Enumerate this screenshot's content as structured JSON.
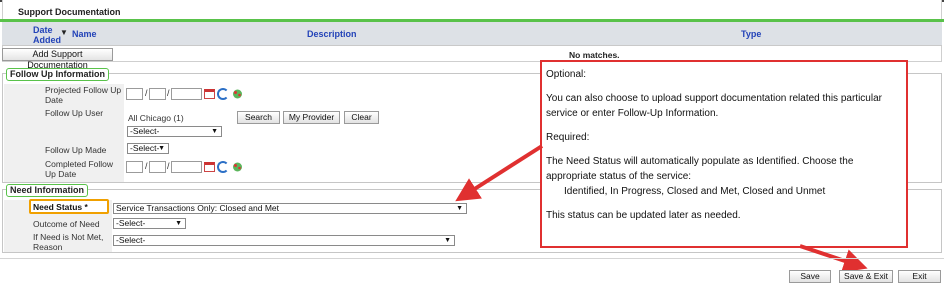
{
  "support_documentation": {
    "title": "Support Documentation",
    "columns": {
      "date_added": "Date Added",
      "name": "Name",
      "description": "Description",
      "type": "Type"
    },
    "add_button": "Add Support Documentation",
    "empty_message": "No matches."
  },
  "follow_up": {
    "legend": "Follow Up Information",
    "projected_label": "Projected Follow Up Date",
    "user_label": "Follow Up User",
    "user_value": "All Chicago (1)",
    "user_select": "-Select-",
    "search_button": "Search",
    "my_provider_button": "My Provider",
    "clear_button": "Clear",
    "made_label": "Follow Up Made",
    "made_select": "-Select-",
    "completed_label": "Completed Follow Up Date",
    "date_sep": "/"
  },
  "need_info": {
    "legend": "Need Information",
    "status_label": "Need Status *",
    "status_value": "Service Transactions Only: Closed and Met",
    "outcome_label": "Outcome of Need",
    "outcome_value": "-Select-",
    "notmet_label": "If Need is Not Met, Reason",
    "notmet_value": "-Select-"
  },
  "annotation": {
    "line1": "Optional:",
    "line2": "You can also choose to upload support documentation related this particular service or enter Follow-Up Information.",
    "line3": "Required:",
    "line4": "The Need Status will automatically populate as Identified.  Choose the appropriate status of the service:",
    "line5": "Identified, In Progress, Closed and Met, Closed and Unmet",
    "line6": "This status can be updated later as needed."
  },
  "footer": {
    "save": "Save",
    "save_exit": "Save & Exit",
    "exit": "Exit"
  },
  "colors": {
    "accent_green": "#59c24a",
    "highlight_orange": "#f0a000",
    "annotation_red": "#e03030",
    "link_blue": "#2343b8"
  },
  "icons": [
    "sort-down-icon",
    "calendar-icon",
    "refresh-icon",
    "tree-icon",
    "dropdown-arrow-icon",
    "red-arrow-icon"
  ]
}
